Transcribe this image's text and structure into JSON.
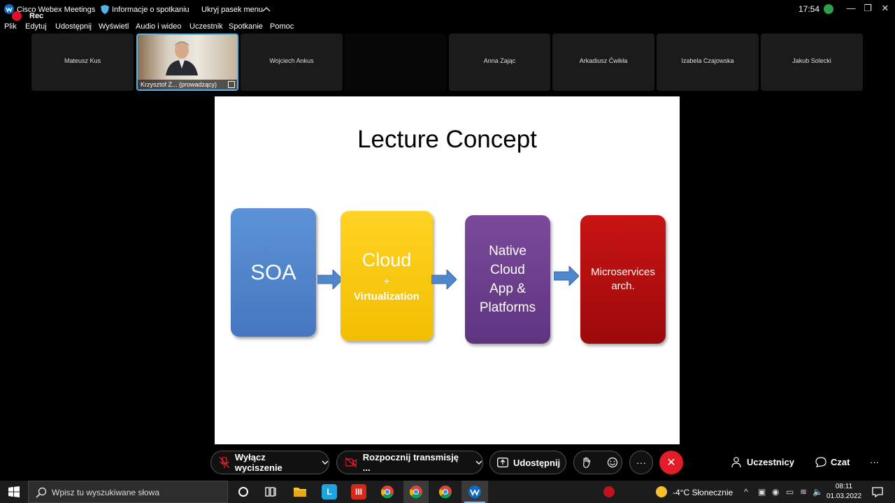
{
  "titlebar": {
    "app_name": "Cisco Webex Meetings",
    "meeting_info": "Informacje o spotkaniu",
    "hide_menu": "Ukryj pasek menu",
    "time": "17:54",
    "rec_label": "Rec"
  },
  "menu": {
    "items": [
      "Plik",
      "Edytuj",
      "Udostępnij",
      "Wyświetl",
      "Audio i wideo",
      "Uczestnik",
      "Spotkanie",
      "Pomoc"
    ]
  },
  "participants": [
    {
      "name": "Mateusz Kus"
    },
    {
      "name": "Krzysztof Z...  (prowadzący)"
    },
    {
      "name": "Wojciech Ankus"
    },
    {
      "name": ""
    },
    {
      "name": "Anna Zając"
    },
    {
      "name": "Arkadiusz Ćwikła"
    },
    {
      "name": "Izabela Czajowska"
    },
    {
      "name": "Jakub Solecki"
    }
  ],
  "slide": {
    "title": "Lecture Concept",
    "box1": "SOA",
    "box2_main": "Cloud",
    "box2_plus": "+",
    "box2_sub": "Virtualization",
    "box3_line1": "Native",
    "box3_line2": "Cloud",
    "box3_line3": "App  &",
    "box3_line4": "Platforms",
    "box4_line1": "Microservices",
    "box4_line2": "arch."
  },
  "controls": {
    "mute_label": "Wyłącz wyciszenie",
    "video_label": "Rozpocznij transmisję ...",
    "share_label": "Udostępnij",
    "more_label": "···",
    "participants_label": "Uczestnicy",
    "chat_label": "Czat",
    "overflow_label": "···"
  },
  "taskbar": {
    "search_placeholder": "Wpisz tu wyszukiwane słowa",
    "weather": "-4°C  Słonecznie",
    "clock_time": "08:11",
    "clock_date": "01.03.2022"
  },
  "colors": {
    "accent_blue": "#4fb4e8",
    "end_call_red": "#e31c2a",
    "soa_blue": "#4f86cc",
    "cloud_yellow": "#f8c800",
    "native_purple": "#6b3d8c",
    "micro_red": "#b40f0f"
  }
}
